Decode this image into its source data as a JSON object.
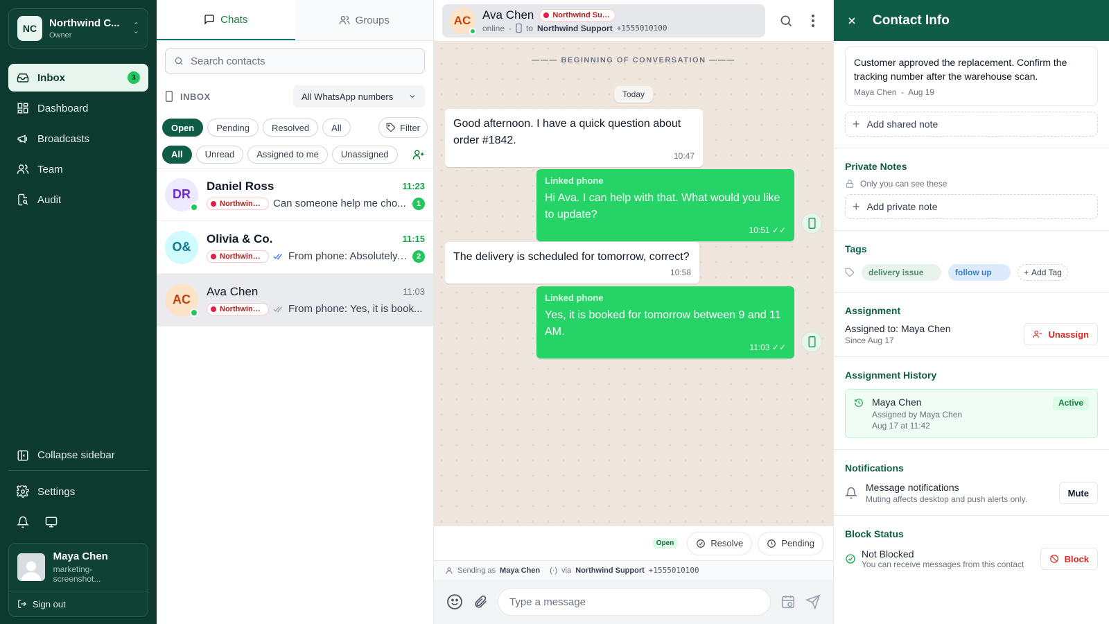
{
  "sidebar": {
    "org": {
      "logo": "NC",
      "name": "Northwind C...",
      "role": "Owner"
    },
    "items": [
      {
        "label": "Inbox",
        "badge": "3",
        "active": true
      },
      {
        "label": "Dashboard"
      },
      {
        "label": "Broadcasts"
      },
      {
        "label": "Team"
      },
      {
        "label": "Audit"
      }
    ],
    "collapse_label": "Collapse sidebar",
    "settings_label": "Settings",
    "user": {
      "name": "Maya Chen",
      "email": "marketing-screenshot..."
    },
    "signout_label": "Sign out"
  },
  "list": {
    "tabs": [
      {
        "label": "Chats"
      },
      {
        "label": "Groups"
      }
    ],
    "search_placeholder": "Search contacts",
    "inbox_label": "INBOX",
    "number_select": "All WhatsApp numbers",
    "status_pills": [
      "Open",
      "Pending",
      "Resolved",
      "All"
    ],
    "filter_label": "Filter",
    "assign_pills": [
      "All",
      "Unread",
      "Assigned to me",
      "Unassigned"
    ],
    "chats": [
      {
        "initials": "DR",
        "name": "Daniel Ross",
        "time": "11:23",
        "tag": "Northwind ...",
        "preview": "Can someone help me cho...",
        "unread": "1",
        "bg": "#ede9fe",
        "fg": "#6d28d9"
      },
      {
        "initials": "O&",
        "name": "Olivia & Co.",
        "time": "11:15",
        "tag": "Northwind ...",
        "preview": "From phone: Absolutely....",
        "unread": "2",
        "bg": "#cffafe",
        "fg": "#0e7490"
      },
      {
        "initials": "AC",
        "name": "Ava Chen",
        "time": "11:03",
        "tag": "Northwind ...",
        "preview": "From phone: Yes, it is book...",
        "bg": "#fde4c8",
        "fg": "#c2410c"
      }
    ]
  },
  "chat": {
    "header": {
      "initials": "AC",
      "name": "Ava Chen",
      "tag": "Northwind Sup...",
      "status": "online",
      "to": "to",
      "channel": "Northwind Support",
      "number": "+1555010100"
    },
    "begin_label": "BEGINNING OF CONVERSATION",
    "today_label": "Today",
    "messages": [
      {
        "dir": "in",
        "text": "Good afternoon. I have a quick question about order #1842.",
        "time": "10:47"
      },
      {
        "dir": "out",
        "label": "Linked phone",
        "text": "Hi Ava. I can help with that. What would you like to update?",
        "time": "10:51"
      },
      {
        "dir": "in",
        "text": "The delivery is scheduled for tomorrow, correct?",
        "time": "10:58"
      },
      {
        "dir": "out",
        "label": "Linked phone",
        "text": "Yes, it is booked for tomorrow between 9 and 11 AM.",
        "time": "11:03"
      }
    ],
    "status_badge": "Open",
    "resolve_label": "Resolve",
    "pending_label": "Pending",
    "sending_as": "Sending as",
    "sender": "Maya Chen",
    "via": "via",
    "channel": "Northwind Support",
    "number": "+1555010100",
    "input_placeholder": "Type a message"
  },
  "info": {
    "title": "Contact Info",
    "shared_note": {
      "text": "Customer approved the replacement. Confirm the tracking number after the warehouse scan.",
      "author": "Maya Chen",
      "sep": "-",
      "date": "Aug 19"
    },
    "add_shared_note": "Add shared note",
    "private_title": "Private Notes",
    "private_sub": "Only you can see these",
    "add_private_note": "Add private note",
    "tags_title": "Tags",
    "tags": [
      "delivery issue",
      "follow up"
    ],
    "add_tag": "Add Tag",
    "assignment_title": "Assignment",
    "assigned_label": "Assigned to:",
    "assigned_to": "Maya Chen",
    "since": "Since Aug 17",
    "unassign_label": "Unassign",
    "history_title": "Assignment History",
    "history": {
      "name": "Maya Chen",
      "by": "Assigned by Maya Chen",
      "date": "Aug 17 at 11:42",
      "status": "Active"
    },
    "notif_title": "Notifications",
    "notif_name": "Message notifications",
    "notif_sub": "Muting affects desktop and push alerts only.",
    "mute_label": "Mute",
    "block_title": "Block Status",
    "block_name": "Not Blocked",
    "block_sub": "You can receive messages from this contact",
    "block_label": "Block"
  }
}
